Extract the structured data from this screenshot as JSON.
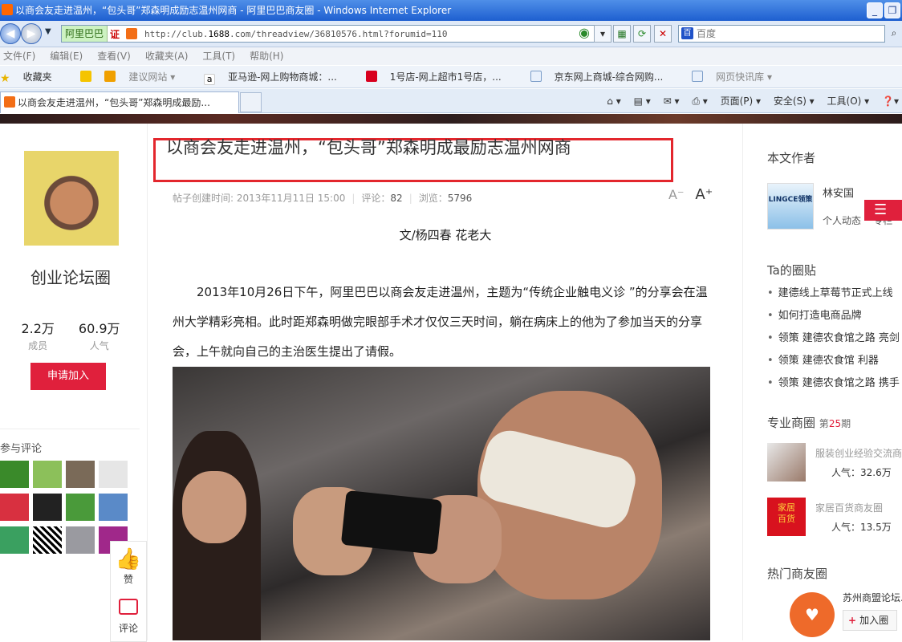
{
  "browser": {
    "window_title": "以商会友走进温州，“包头哥”郑森明成励志温州网商 - 阿里巴巴商友圈 - Windows Internet Explorer",
    "address_badge": "阿里巴巴",
    "address_cert": "证",
    "url_prefix": "http://club.",
    "url_domain": "1688",
    "url_suffix": ".com/threadview/36810576.html?forumid=110",
    "search_placeholder": "百度",
    "menu": [
      "文件(F)",
      "编辑(E)",
      "查看(V)",
      "收藏夹(A)",
      "工具(T)",
      "帮助(H)"
    ],
    "favorites_label": "收藏夹",
    "favorites": [
      "建议网站 ▾",
      "亚马逊-网上购物商城：...",
      "1号店-网上超市1号店，...",
      "京东网上商城-综合网购...",
      "网页快讯库 ▾"
    ],
    "tab_title": "以商会友走进温州，“包头哥”郑森明成最励...",
    "commands": [
      "页面(P) ▾",
      "安全(S) ▾",
      "工具(O) ▾"
    ]
  },
  "left": {
    "circle_name": "创业论坛圈",
    "members_count": "2.2万",
    "members_label": "成员",
    "popularity_count": "60.9万",
    "popularity_label": "人气",
    "join_button": "申请加入",
    "participants_label": "参与评论",
    "like_label": "赞",
    "comment_label": "评论"
  },
  "article": {
    "title": "以商会友走进温州，“包头哥”郑森明成最励志温州网商",
    "created_label": "帖子创建时间:",
    "created": "2013年11月11日 15:00",
    "comments_label": "评论：",
    "comments": "82",
    "views_label": "浏览：",
    "views": "5796",
    "font_small": "A⁻",
    "font_large": "A⁺",
    "byline": "文/杨四春 花老大",
    "paragraph": "2013年10月26日下午，阿里巴巴以商会友走进温州，主题为“传统企业触电义诊 ”的分享会在温州大学精彩亮相。此时距郑森明做完眼部手术才仅仅三天时间，躺在病床上的他为了参加当天的分享会，上午就向自己的主治医生提出了请假。"
  },
  "right": {
    "author_heading": "本文作者",
    "author_logo": "LINGCE领策",
    "author_name": "林安国",
    "author_link1": "个人动态",
    "author_link2": "专栏",
    "ta_heading": "Ta的圈贴",
    "ta_posts": [
      "建德线上草莓节正式上线",
      "如何打造电商品牌",
      "领策 建德农食馆之路 亮剑",
      "领策 建德农食馆 利器",
      "领策 建德农食馆之路 携手"
    ],
    "biz_heading": "专业商圈",
    "biz_issue_pre": "第",
    "biz_issue": "25",
    "biz_issue_post": "期",
    "biz1_name": "服装创业经验交流商...",
    "biz1_pop": "人气：32.6万",
    "biz2_name": "家居百货商友圈",
    "biz2_pop": "人气：13.5万",
    "hot_heading": "热门商友圈",
    "hot_name": "苏州商盟论坛...",
    "hot_join": "加入圈"
  },
  "colors": {
    "accent": "#e0203c",
    "highlight_box": "#e3262d",
    "ie_title": "#1e5fd0"
  }
}
